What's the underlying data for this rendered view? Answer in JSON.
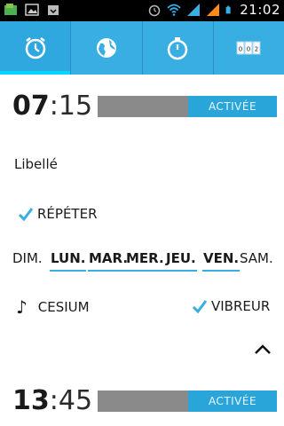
{
  "status_bar": {
    "time": "21:02",
    "icons": [
      "app-notification-icon",
      "image-icon",
      "download-icon",
      "alarm-icon",
      "wifi-icon",
      "signal-icon",
      "signal-alt-icon",
      "battery-icon"
    ]
  },
  "tabs": [
    {
      "name": "alarm",
      "icon": "alarm-clock-icon",
      "active": true
    },
    {
      "name": "world-clock",
      "icon": "globe-icon",
      "active": false
    },
    {
      "name": "stopwatch",
      "icon": "stopwatch-icon",
      "active": false
    },
    {
      "name": "timer",
      "icon": "timer-counter-icon",
      "counter": "0 0 2",
      "active": false
    }
  ],
  "alarms": [
    {
      "hours": "07",
      "separator": ":",
      "minutes": "15",
      "toggle_label": "ACTIVÉE",
      "label": "Libellé",
      "repeat_label": "RÉPÉTER",
      "repeat_checked": true,
      "days": [
        {
          "label": "DIM.",
          "selected": false
        },
        {
          "label": "LUN.",
          "selected": true
        },
        {
          "label": "MAR.",
          "selected": true
        },
        {
          "label": "MER.",
          "selected": true
        },
        {
          "label": "JEU.",
          "selected": true
        },
        {
          "label": "VEN.",
          "selected": true
        },
        {
          "label": "SAM.",
          "selected": false
        }
      ],
      "ringtone": "CESIUM",
      "vibrate_label": "VIBREUR",
      "vibrate_checked": true
    },
    {
      "hours": "13",
      "separator": ":",
      "minutes": "45",
      "toggle_label": "ACTIVÉE"
    }
  ],
  "colors": {
    "accent": "#39aee3",
    "active_indicator": "#00d8ff",
    "toggle_on": "#2aa5d9",
    "toggle_off": "#8a8a8a"
  }
}
